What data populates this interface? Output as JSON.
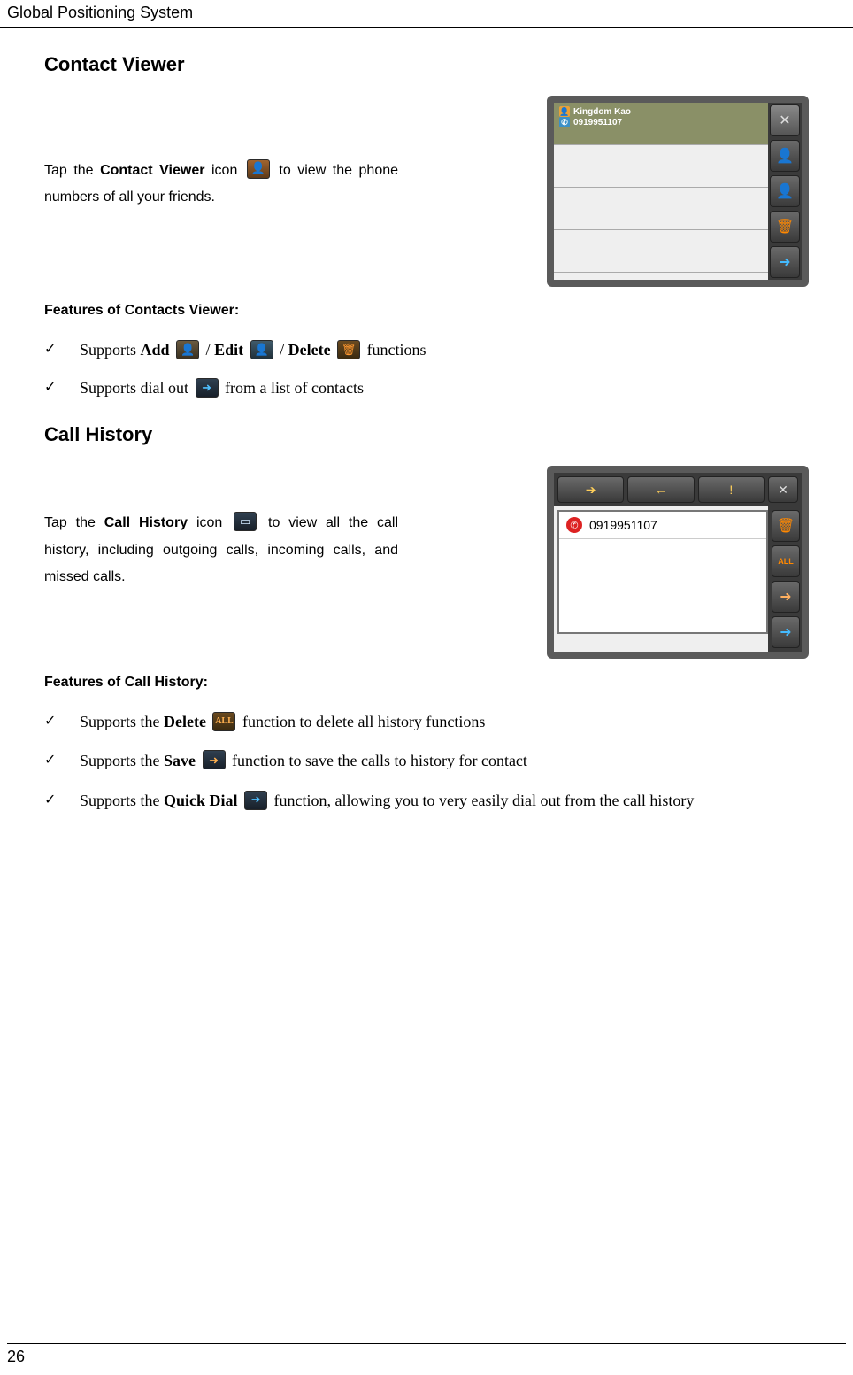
{
  "header": "Global Positioning System",
  "page_number": "26",
  "contact_viewer": {
    "title": "Contact Viewer",
    "para_pre": "Tap the ",
    "para_bold": "Contact Viewer",
    "para_mid": " icon ",
    "para_post": " to view the phone numbers of all your friends.",
    "features_heading": "Features of Contacts Viewer:",
    "feat1_pre": "Supports ",
    "feat1_add": "Add",
    "feat1_slash1": " / ",
    "feat1_edit": "Edit",
    "feat1_slash2": " / ",
    "feat1_del": "Delete",
    "feat1_post": " functions",
    "feat2_pre": "Supports dial out ",
    "feat2_post": " from a list of contacts",
    "screenshot": {
      "contact_name": "Kingdom Kao",
      "contact_number": "0919951107"
    }
  },
  "call_history": {
    "title": "Call History",
    "para_pre": "Tap the ",
    "para_bold": "Call History",
    "para_mid": " icon ",
    "para_post": " to view all the call history, including outgoing calls, incoming calls, and missed calls.",
    "features_heading": "Features of Call History:",
    "feat1_pre": "Supports the ",
    "feat1_bold": "Delete",
    "feat1_post": " function to delete all history functions",
    "feat2_pre": "Supports the ",
    "feat2_bold": "Save",
    "feat2_post": " function to save the calls to history for contact",
    "feat3_pre": "Supports the ",
    "feat3_bold": "Quick Dial",
    "feat3_post": " function, allowing you to very easily dial out from the call history",
    "screenshot": {
      "number": "0919951107",
      "delall": "ALL"
    }
  },
  "glyphs": {
    "contact": "👤",
    "plus": "＋",
    "pencil": "✎",
    "trash": "🗑",
    "arrow_right": "➜",
    "phone": "✆",
    "close": "✕",
    "arrow_out": "➔",
    "arrow_in": "←",
    "bang": "!",
    "card": "▭"
  }
}
